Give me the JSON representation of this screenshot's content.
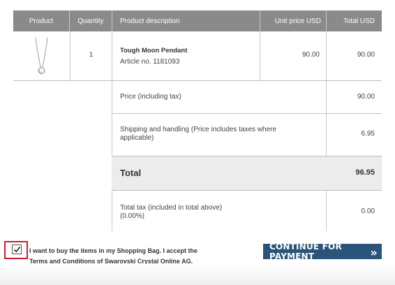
{
  "table": {
    "headers": [
      "Product",
      "Quantity",
      "Product description",
      "Unit price USD",
      "Total USD"
    ],
    "item": {
      "image_icon": "pendant-necklace-icon",
      "quantity": "1",
      "name": "Tough Moon Pendant",
      "article": "Article no. 1181093",
      "unit_price": "90.00",
      "total": "90.00"
    },
    "summary": [
      {
        "label": "Price (including tax)",
        "value": "90.00"
      },
      {
        "label": "Shipping and handling (Price includes taxes where applicable)",
        "value": "6.95"
      }
    ],
    "grand_total": {
      "label": "Total",
      "value": "96.95"
    },
    "tax": {
      "label": "Total tax (included in total above)",
      "sublabel": "(0.00%)",
      "value": "0.00"
    }
  },
  "consent": {
    "checked": true,
    "text_prefix": "I want to buy the items in my Shopping Bag. I accept the",
    "link_text": "Terms and Conditions",
    "text_suffix": "of Swarovski Crystal Online AG."
  },
  "cta": {
    "label": "CONTINUE FOR PAYMENT",
    "icon": "double-chevron-right-icon",
    "color": "#2a5479"
  },
  "colors": {
    "header_bg": "#8a8a8a",
    "total_row_bg": "#ececec",
    "highlight": "#d01f2a"
  }
}
